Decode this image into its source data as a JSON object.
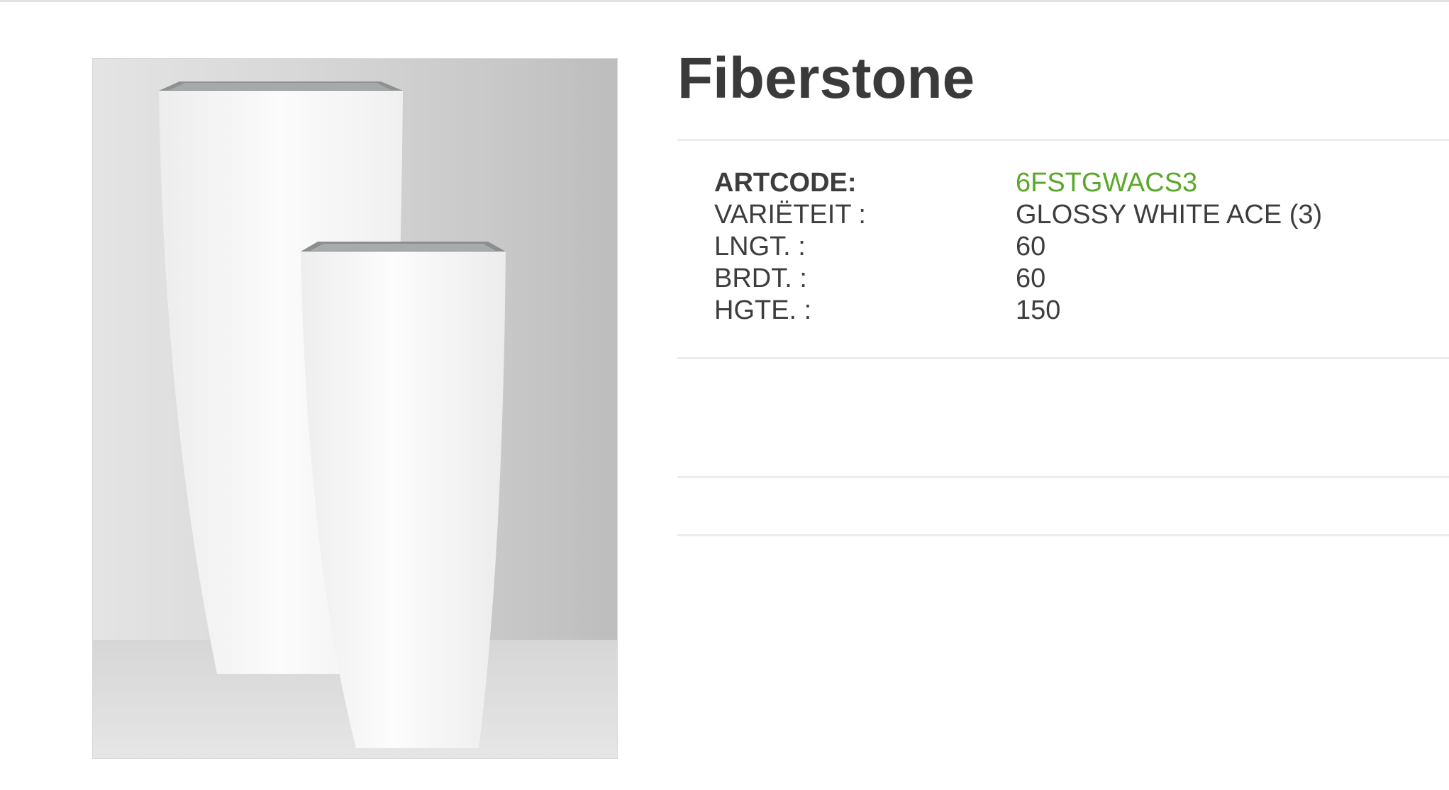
{
  "product": {
    "title": "Fiberstone",
    "image_alt": "Two tall glossy white tapered planters",
    "specs": [
      {
        "label": "ARTCODE:",
        "value": "6FSTGWACS3"
      },
      {
        "label": "VARIËTEIT :",
        "value": "GLOSSY WHITE ACE (3)"
      },
      {
        "label": "LNGT. :",
        "value": "60"
      },
      {
        "label": "BRDT. :",
        "value": "60"
      },
      {
        "label": "HGTE. :",
        "value": "150"
      }
    ]
  },
  "colors": {
    "artcode_accent": "#5aa82a",
    "text": "#3d3d3d",
    "divider": "#ececec"
  }
}
